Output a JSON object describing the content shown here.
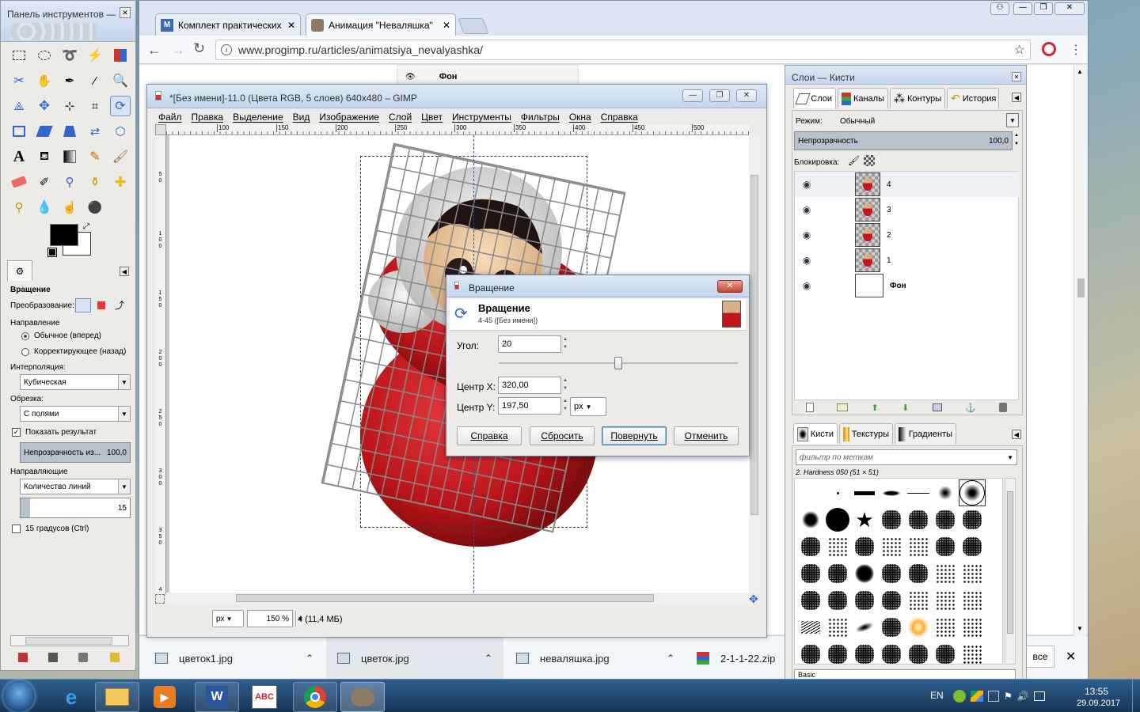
{
  "toolbox": {
    "title": "Панель инструментов —",
    "options_title": "Вращение",
    "transform_label": "Преобразование:",
    "direction_label": "Направление",
    "dir_normal": "Обычное (вперед)",
    "dir_corrective": "Корректирующее (назад)",
    "interp_label": "Интерполяция:",
    "interp_value": "Кубическая",
    "clip_label": "Обрезка:",
    "clip_value": "С полями",
    "show_preview": "Показать результат",
    "preview_opacity_label": "Непрозрачность из...",
    "preview_opacity_value": "100,0",
    "guides_label": "Направляющие",
    "guides_value": "Количество линий",
    "guides_count": "15",
    "snap15": "15 градусов  (Ctrl)"
  },
  "browser": {
    "tab1": "Комплект практических",
    "tab2": "Анимация \"Неваляшка\"",
    "url": "www.progimp.ru/articles/animatsiya_nevalyashka/",
    "page_layer_label": "Фон"
  },
  "gimp": {
    "title": "*[Без имени]-11.0 (Цвета RGB, 5 слоев) 640x480 – GIMP",
    "menu": [
      "Файл",
      "Правка",
      "Выделение",
      "Вид",
      "Изображение",
      "Слой",
      "Цвет",
      "Инструменты",
      "Фильтры",
      "Окна",
      "Справка"
    ],
    "ruler": [
      "100",
      "150",
      "200",
      "250",
      "300",
      "350",
      "400",
      "450",
      "500"
    ],
    "ruler_v": [
      "5\n0",
      "1\n0\n0",
      "1\n5\n0",
      "2\n0\n0",
      "2\n5\n0",
      "3\n0\n0",
      "3\n5\n0",
      "4"
    ],
    "unit": "px",
    "zoom": "150 %",
    "status": "4 (11,4 МБ)"
  },
  "rotate_dialog": {
    "title": "Вращение",
    "heading": "Вращение",
    "subheading": "4-45 ([Без имени])",
    "angle_label": "Угол:",
    "angle_value": "20",
    "angle_fraction": 0.5,
    "cx_label": "Центр X:",
    "cx_value": "320,00",
    "cy_label": "Центр Y:",
    "cy_value": "197,50",
    "unit": "px",
    "btn_help": "Справка",
    "btn_reset": "Сбросить",
    "btn_rotate": "Повернуть",
    "btn_cancel": "Отменить"
  },
  "layers_panel": {
    "title": "Слои — Кисти",
    "tabs": [
      "Слои",
      "Каналы",
      "Контуры",
      "История"
    ],
    "mode_label": "Режим:",
    "mode_value": "Обычный",
    "opacity_label": "Непрозрачность",
    "opacity_value": "100,0",
    "lock_label": "Блокировка:",
    "layers": [
      {
        "name": "4",
        "selected": true
      },
      {
        "name": "3",
        "selected": false
      },
      {
        "name": "2",
        "selected": false
      },
      {
        "name": "1",
        "selected": false
      },
      {
        "name": "Фон",
        "selected": false
      }
    ]
  },
  "brushes_panel": {
    "tabs": [
      "Кисти",
      "Текстуры",
      "Градиенты"
    ],
    "filter_placeholder": "фильтр по меткам",
    "brush_name": "2. Hardness 050 (51 × 51)",
    "footer": "Basic"
  },
  "downloads": {
    "items": [
      "цветок1.jpg",
      "цветок.jpg",
      "неваляшка.jpg",
      "2-1-1-22.zip"
    ],
    "show_all": "все"
  },
  "taskbar": {
    "lang": "EN",
    "time": "13:55",
    "date": "29.09.2017"
  },
  "colors": {
    "accent": "#6e92c2",
    "taskbar": "#1d3f63",
    "doll_red": "#c0161c"
  }
}
